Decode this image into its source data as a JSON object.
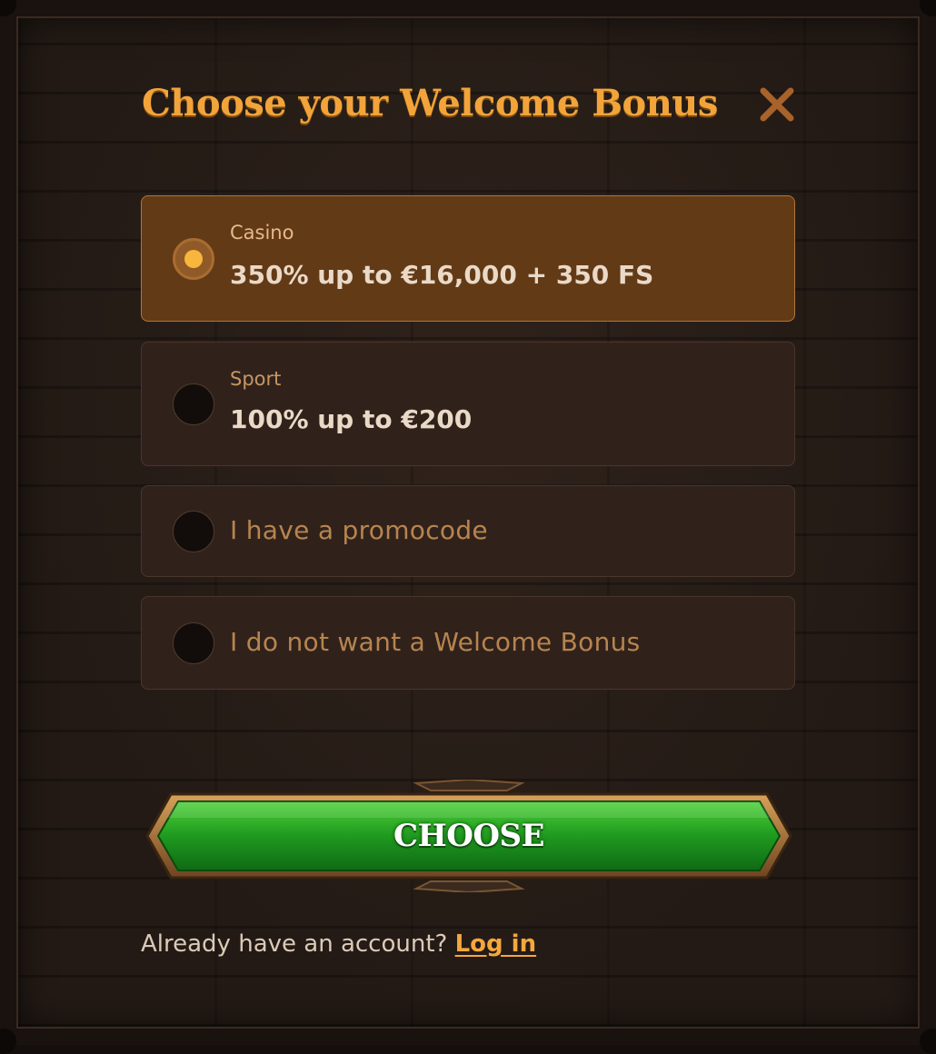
{
  "dialog": {
    "title": "Choose your Welcome Bonus",
    "close_icon": "close-icon"
  },
  "options": [
    {
      "label": "Casino",
      "value": "350% up to €16,000 + 350 FS",
      "selected": true
    },
    {
      "label": "Sport",
      "value": "100% up to €200",
      "selected": false
    },
    {
      "text": "I have a promocode",
      "selected": false
    },
    {
      "text": "I do not want a Welcome Bonus",
      "selected": false
    }
  ],
  "choose_button": {
    "label": "CHOOSE"
  },
  "footer": {
    "prompt": "Already have an account?",
    "login_link": "Log in"
  },
  "colors": {
    "accent": "#f2a43a",
    "selected_bg": "#623a16",
    "option_bg": "#30221b",
    "button_green": "#1f9a1f"
  }
}
